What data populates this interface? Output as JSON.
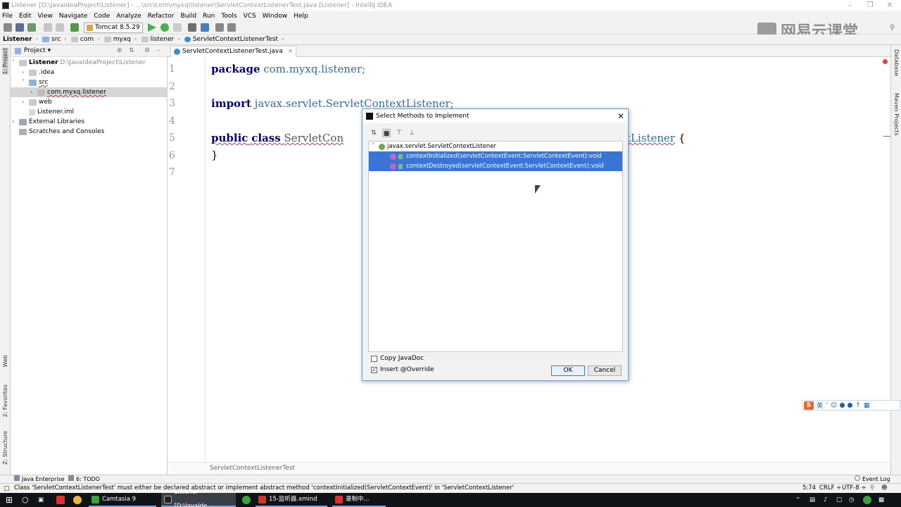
{
  "window": {
    "title": "Listener [D:\\JavaIdeaProject\\Listener] - ...\\src\\com\\myxq\\listener\\ServletContextListenerTest.java [Listener] - IntelliJ IDEA"
  },
  "menu": [
    "File",
    "Edit",
    "View",
    "Navigate",
    "Code",
    "Analyze",
    "Refactor",
    "Build",
    "Run",
    "Tools",
    "VCS",
    "Window",
    "Help"
  ],
  "toolbar": {
    "run_config": "Tomcat 8.5.29"
  },
  "watermark": {
    "text": "网易云课堂"
  },
  "breadcrumb": [
    "Listener",
    "src",
    "com",
    "myxq",
    "listener",
    "ServletContextListenerTest"
  ],
  "left_strip": {
    "project": "1: Project",
    "web": "Web",
    "favorites": "2: Favorites",
    "structure": "Z: Structure"
  },
  "right_strip": {
    "database": "Database",
    "maven": "Maven Projects"
  },
  "project_panel": {
    "header": "Project",
    "tree": [
      {
        "label": "Listener",
        "path": "D:\\JavaIdeaProject\\Listener"
      },
      {
        "label": ".idea"
      },
      {
        "label": "src"
      },
      {
        "label": "com.myxq.listener"
      },
      {
        "label": "web"
      },
      {
        "label": "Listener.iml"
      },
      {
        "label": "External Libraries"
      },
      {
        "label": "Scratches and Consoles"
      }
    ]
  },
  "editor": {
    "tab": "ServletContextListenerTest.java",
    "line_numbers": [
      "1",
      "2",
      "3",
      "4",
      "5",
      "6",
      "7"
    ],
    "line1": {
      "kw": "package",
      "rest": " com.myxq.listener;"
    },
    "line3": {
      "kw": "import",
      "rest": " javax.servlet.ServletContextListener;"
    },
    "line5": {
      "kw1": "public",
      "kw2": "class",
      "name": "ServletCon",
      "tail": "tListener",
      "brace": " {"
    },
    "line6": "}",
    "bottom_crumb": "ServletContextListenerTest"
  },
  "dialog": {
    "title": "Select Methods to Implement",
    "interface": "javax.servlet.ServletContextListener",
    "methods": [
      "contextInitialized(servletContextEvent:ServletContextEvent):void",
      "contextDestroyed(servletContextEvent:ServletContextEvent):void"
    ],
    "copy_javadoc": "Copy JavaDoc",
    "insert_override": "Insert @Override",
    "ok": "OK",
    "cancel": "Cancel"
  },
  "ime": {
    "lang": "英"
  },
  "bottom_tools": {
    "java_enterprise": "Java Enterprise",
    "todo": "6: TODO",
    "event_log": "Event Log"
  },
  "status": {
    "message": "Class 'ServletContextListenerTest' must either be declared abstract or implement abstract method 'contextInitialized(ServletContextEvent)' in 'ServletContextListener'",
    "position": "5:74",
    "line_sep": "CRLF",
    "encoding": "UTF-8"
  },
  "taskbar": {
    "camtasia": "Camtasia 9",
    "idea": "Listener [D:\\JavaIde...",
    "xmind": "15-监听器.xmind",
    "recording": "录制中..."
  }
}
